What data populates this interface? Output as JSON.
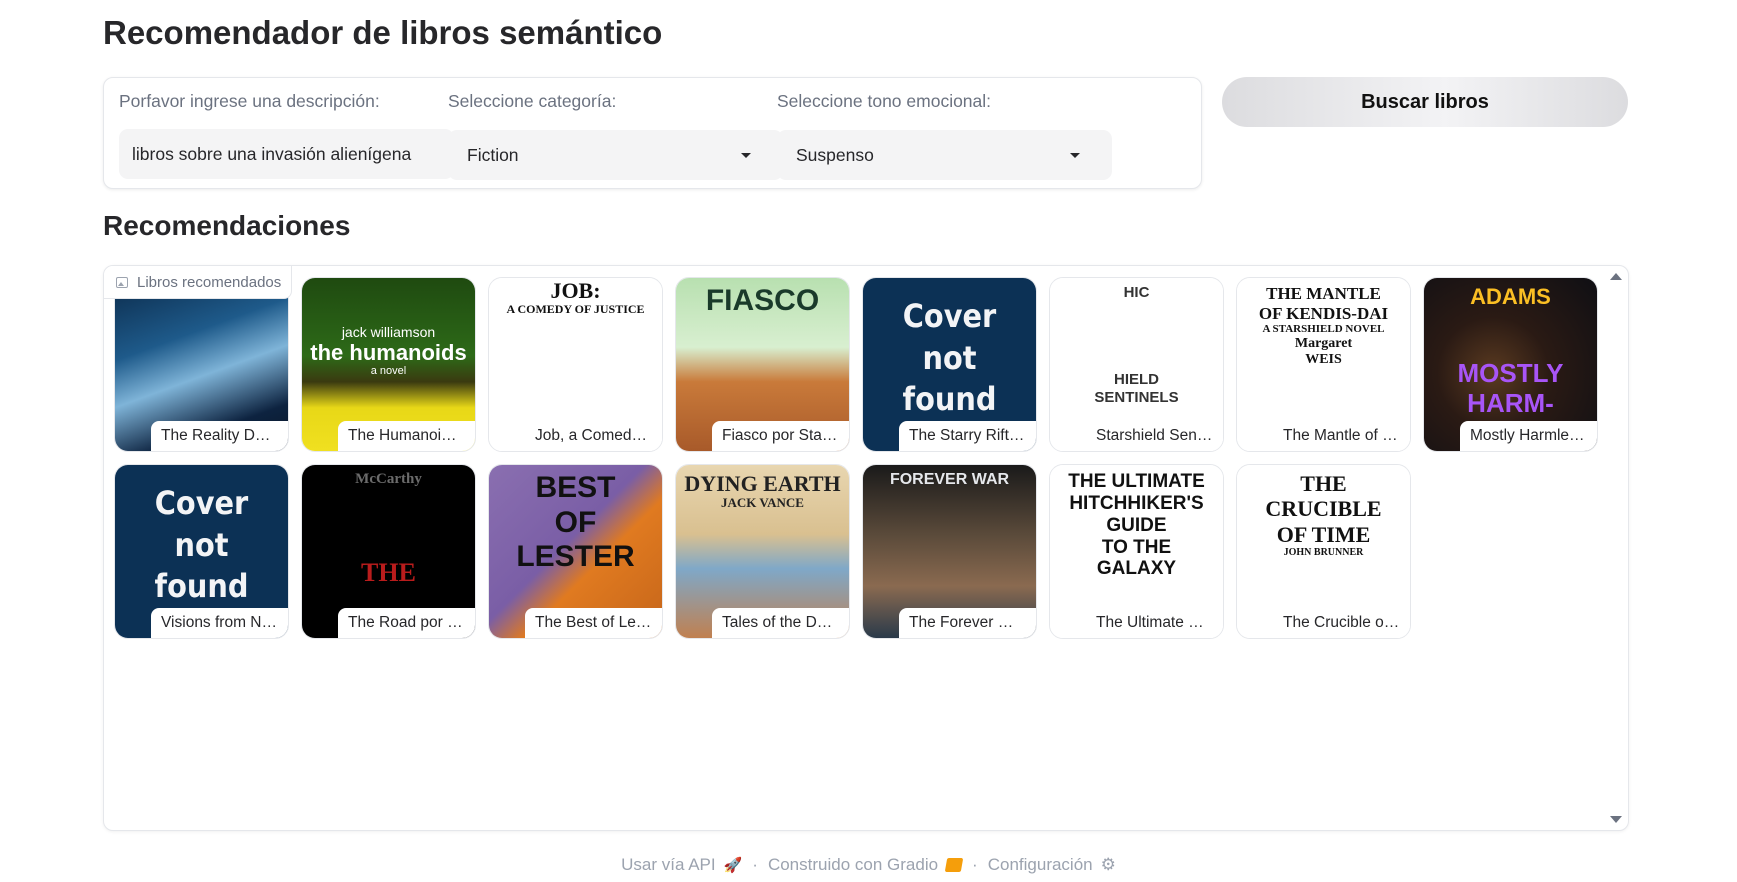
{
  "page": {
    "title": "Recomendador de libros semántico"
  },
  "form": {
    "description": {
      "label": "Porfavor ingrese una descripción:",
      "value": "libros sobre una invasión alienígena"
    },
    "category": {
      "label": "Seleccione categoría:",
      "value": "Fiction"
    },
    "tone": {
      "label": "Seleccione tono emocional:",
      "value": "Suspenso"
    },
    "search_button": "Buscar libros"
  },
  "results": {
    "title": "Recomendaciones",
    "gallery_label": "Libros recomendados",
    "books": [
      {
        "caption": "The Reality Dy…",
        "cover": {
          "style": "space-art",
          "lines": []
        }
      },
      {
        "caption": "The Humanoid…",
        "cover": {
          "style": "humanoids",
          "lines": [
            "jack williamson",
            "the humanoids",
            "a novel"
          ]
        }
      },
      {
        "caption": "Job, a Comedy…",
        "cover": {
          "style": "job",
          "lines": [
            "JOB:",
            "A COMEDY OF JUSTICE"
          ]
        }
      },
      {
        "caption": "Fiasco por Sta…",
        "cover": {
          "style": "fiasco",
          "lines": [
            "FIASCO"
          ]
        }
      },
      {
        "caption": "The Starry Rift …",
        "cover": {
          "style": "not-found",
          "lines": [
            "Cover",
            "not",
            "found"
          ]
        }
      },
      {
        "caption": "Starshield Sent…",
        "cover": {
          "style": "starshield",
          "lines": [
            "HIC",
            "HIELD",
            "SENTINELS"
          ]
        }
      },
      {
        "caption": "The Mantle of …",
        "cover": {
          "style": "mantle",
          "lines": [
            "THE MANTLE",
            "OF KENDIS-DAI",
            "A STARSHIELD NOVEL",
            "Margaret",
            "WEIS"
          ]
        }
      },
      {
        "caption": "Mostly Harmle…",
        "cover": {
          "style": "harmless",
          "lines": [
            "ADAMS",
            "MOSTLY",
            "HARM-"
          ]
        }
      },
      {
        "caption": "Visions from N…",
        "cover": {
          "style": "not-found",
          "lines": [
            "Cover",
            "not",
            "found"
          ]
        }
      },
      {
        "caption": "The Road por …",
        "cover": {
          "style": "road",
          "lines": [
            "McCarthy",
            "THE"
          ]
        }
      },
      {
        "caption": "The Best of Le…",
        "cover": {
          "style": "lester",
          "lines": [
            "BEST",
            "OF",
            "LESTER"
          ]
        }
      },
      {
        "caption": "Tales of the Dyi…",
        "cover": {
          "style": "dying",
          "lines": [
            "DYING EARTH",
            "JACK VANCE"
          ]
        }
      },
      {
        "caption": "The Forever W…",
        "cover": {
          "style": "forever",
          "lines": [
            "FOREVER WAR"
          ]
        }
      },
      {
        "caption": "The Ultimate H…",
        "cover": {
          "style": "hitchhiker",
          "lines": [
            "THE ULTIMATE",
            "HITCHHIKER'S",
            "GUIDE",
            "TO THE",
            "GALAXY"
          ]
        }
      },
      {
        "caption": "The Crucible of…",
        "cover": {
          "style": "crucible",
          "lines": [
            "THE",
            "CRUCIBLE",
            "OF TIME",
            "JOHN BRUNNER"
          ]
        }
      }
    ]
  },
  "footer": {
    "api": "Usar vía API",
    "built": "Construido con Gradio",
    "settings": "Configuración",
    "separator": "·"
  },
  "colors": {
    "not_found_bg": "#0c3155",
    "accent_orange": "#f97316"
  }
}
